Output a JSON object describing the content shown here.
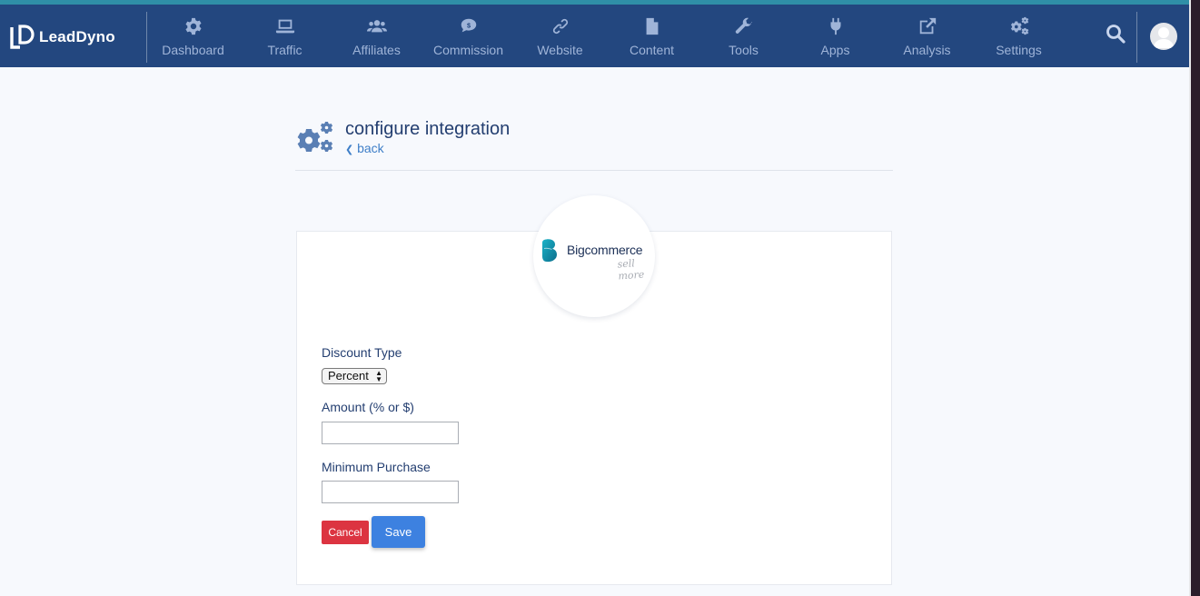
{
  "app": {
    "brand_name": "LeadDyno"
  },
  "nav": {
    "items": [
      {
        "label": "Dashboard",
        "icon": "gear-icon"
      },
      {
        "label": "Traffic",
        "icon": "laptop-icon"
      },
      {
        "label": "Affiliates",
        "icon": "users-icon"
      },
      {
        "label": "Commission",
        "icon": "coins-icon"
      },
      {
        "label": "Website",
        "icon": "link-icon"
      },
      {
        "label": "Content",
        "icon": "file-icon"
      },
      {
        "label": "Tools",
        "icon": "wrench-icon"
      },
      {
        "label": "Apps",
        "icon": "plug-icon"
      },
      {
        "label": "Analysis",
        "icon": "external-link-icon"
      },
      {
        "label": "Settings",
        "icon": "cogs-icon"
      }
    ]
  },
  "page": {
    "title": "configure integration",
    "back_label": "back"
  },
  "integration": {
    "logo_name": "Bigcommerce",
    "logo_tagline": "sell more"
  },
  "form": {
    "discount_type_label": "Discount Type",
    "discount_type_value": "Percent",
    "amount_label": "Amount (% or $)",
    "amount_value": "",
    "min_purchase_label": "Minimum Purchase",
    "min_purchase_value": "",
    "cancel_label": "Cancel",
    "save_label": "Save"
  },
  "colors": {
    "nav_bg": "#23477f",
    "nav_top_accent": "#2f8fa7",
    "nav_icon": "#9fb4d8",
    "title_text": "#233e70",
    "link": "#3f7fc8",
    "cancel_button": "#dc3441",
    "save_button": "#3d81e0"
  }
}
